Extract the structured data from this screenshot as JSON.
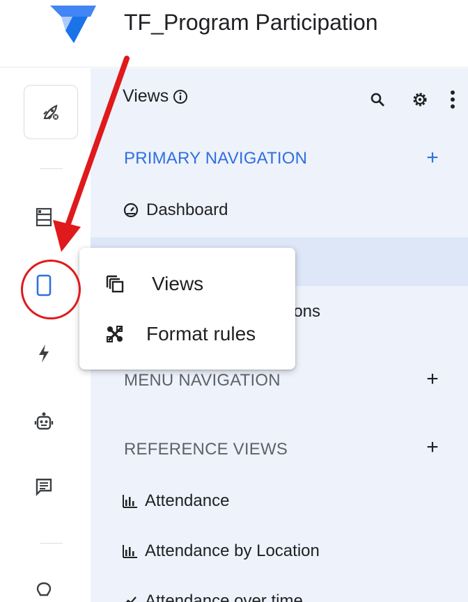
{
  "header": {
    "app_title": "TF_Program Participation",
    "logo_icon": "appsheet-logo-icon"
  },
  "colors": {
    "accent_blue": "#2f6fe0",
    "panel_bg": "#eef2fb",
    "selected_row": "#dde7f8",
    "annotation_red": "#e0191b"
  },
  "rail": {
    "items": [
      {
        "icon": "rocket-icon"
      },
      {
        "icon": "data-table-icon"
      },
      {
        "icon": "mobile-app-icon"
      },
      {
        "icon": "lightning-icon"
      },
      {
        "icon": "robot-icon"
      },
      {
        "icon": "chat-icon"
      },
      {
        "icon": "lightbulb-icon"
      }
    ]
  },
  "panel": {
    "title": "Views",
    "info_icon": "info-icon",
    "primary_section": "PRIMARY NAVIGATION",
    "menu_section": "MENU NAVIGATION",
    "reference_section": "REFERENCE VIEWS",
    "plus": "+",
    "primary_items": [
      {
        "label": "Dashboard",
        "icon": "dashboard-gauge-icon"
      }
    ],
    "partial_text": "ions",
    "reference_items": [
      {
        "label": "Attendance",
        "icon": "bar-chart-icon"
      },
      {
        "label": "Attendance by Location",
        "icon": "bar-chart-icon"
      },
      {
        "label": "Attendance over time",
        "icon": "line-chart-icon"
      }
    ]
  },
  "popup": {
    "items": [
      {
        "label": "Views",
        "icon": "copy-views-icon"
      },
      {
        "label": "Format rules",
        "icon": "format-rules-icon"
      }
    ]
  }
}
